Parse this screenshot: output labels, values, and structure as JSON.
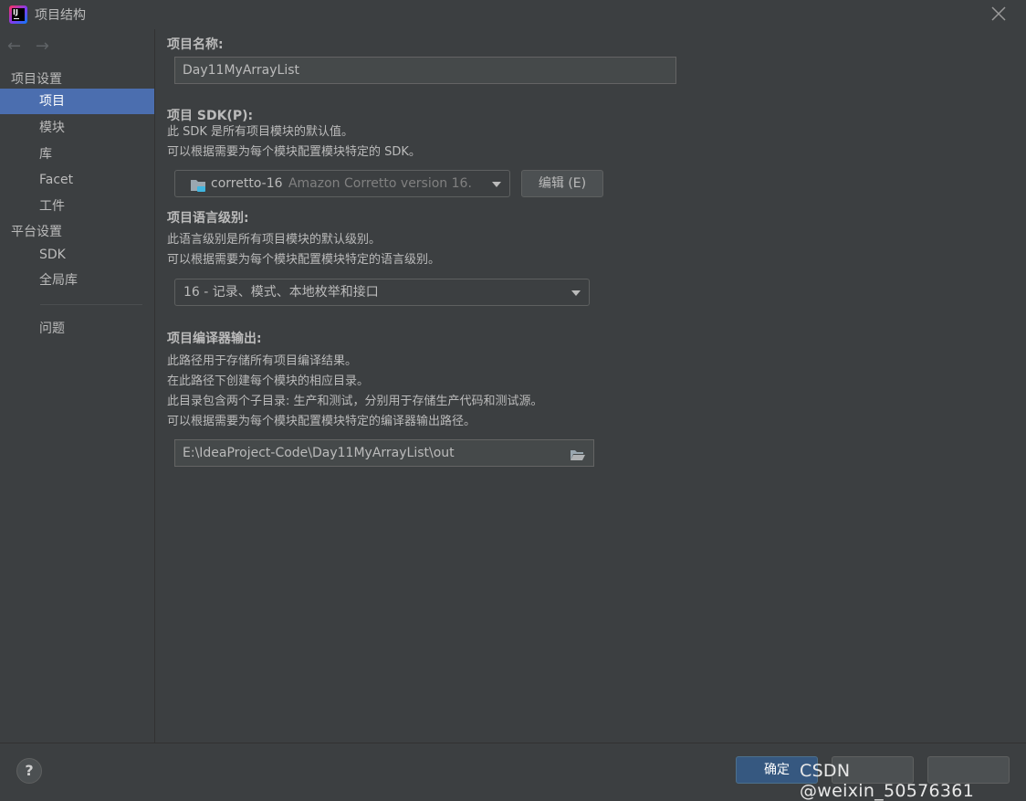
{
  "window": {
    "title": "项目结构"
  },
  "sidebar": {
    "back_arrow": "←",
    "forward_arrow": "→",
    "section_project_settings": "项目设置",
    "items_project": [
      {
        "label": "项目",
        "active": true
      },
      {
        "label": "模块"
      },
      {
        "label": "库"
      },
      {
        "label": "Facet"
      },
      {
        "label": "工件"
      }
    ],
    "section_platform_settings": "平台设置",
    "items_platform": [
      {
        "label": "SDK"
      },
      {
        "label": "全局库"
      }
    ],
    "problems": "问题"
  },
  "project_name": {
    "label": "项目名称:",
    "value": "Day11MyArrayList"
  },
  "sdk": {
    "label": "项目 SDK(P):",
    "desc1": "此 SDK 是所有项目模块的默认值。",
    "desc2": "可以根据需要为每个模块配置模块特定的 SDK。",
    "selected_name": "corretto-16",
    "selected_detail": "Amazon Corretto version 16.",
    "edit_button": "编辑 (E)"
  },
  "language_level": {
    "label": "项目语言级别:",
    "desc1": "此语言级别是所有项目模块的默认级别。",
    "desc2": "可以根据需要为每个模块配置模块特定的语言级别。",
    "selected": "16 - 记录、模式、本地枚举和接口"
  },
  "compiler_output": {
    "label": "项目编译器输出:",
    "desc1": "此路径用于存储所有项目编译结果。",
    "desc2": "在此路径下创建每个模块的相应目录。",
    "desc3": "此目录包含两个子目录: 生产和测试，分别用于存储生产代码和测试源。",
    "desc4": "可以根据需要为每个模块配置模块特定的编译器输出路径。",
    "path": "E:\\IdeaProject-Code\\Day11MyArrayList\\out"
  },
  "footer": {
    "help": "?",
    "ok_button": "确定",
    "watermark": "CSDN @weixin_50576361"
  },
  "colors": {
    "background": "#3c3f41",
    "selection": "#4b6eaf",
    "primary_button": "#365880",
    "text": "#bbbbbb"
  }
}
